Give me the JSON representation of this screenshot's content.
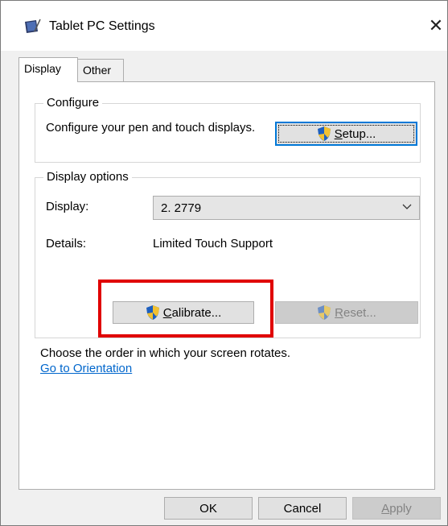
{
  "window": {
    "title": "Tablet PC Settings",
    "icon": "tablet-pc-icon",
    "close_glyph": "✕"
  },
  "tabs": [
    {
      "label": "Display",
      "active": true
    },
    {
      "label": "Other",
      "active": false
    }
  ],
  "configure": {
    "group_label": "Configure",
    "description": "Configure your pen and touch displays.",
    "setup_button": {
      "accel": "S",
      "rest": "etup..."
    }
  },
  "display_options": {
    "group_label": "Display options",
    "display_label": "Display:",
    "display_value": "2. 2779",
    "details_label": "Details:",
    "details_value": "Limited Touch Support",
    "calibrate_button": {
      "accel": "C",
      "rest": "alibrate..."
    },
    "reset_button": {
      "accel": "R",
      "rest": "eset...",
      "disabled": true
    }
  },
  "orientation": {
    "text": "Choose the order in which your screen rotates.",
    "link": "Go to Orientation"
  },
  "footer": {
    "ok": "OK",
    "cancel": "Cancel",
    "apply": {
      "accel": "A",
      "rest": "pply",
      "disabled": true
    }
  },
  "colors": {
    "highlight": "#e00000",
    "link": "#0066cc",
    "focus_border": "#0078d7"
  }
}
